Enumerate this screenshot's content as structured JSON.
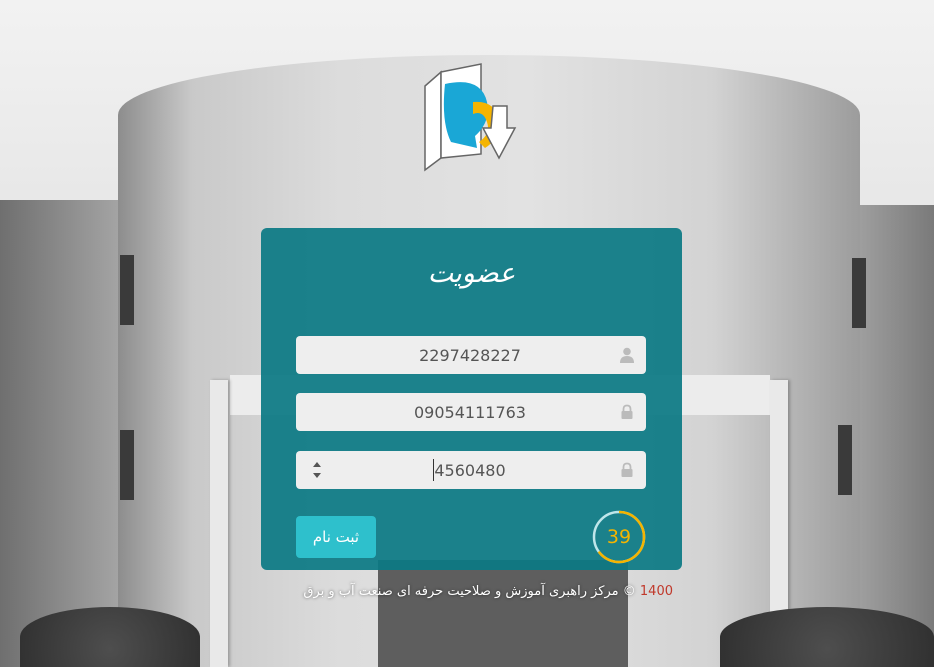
{
  "card": {
    "title": "عضویت",
    "fields": [
      {
        "value": "2297428227",
        "icon": "user-icon"
      },
      {
        "value": "09054111763",
        "icon": "lock-icon"
      },
      {
        "value": "4560480",
        "icon": "lock-icon"
      }
    ],
    "submit_label": "ثبت نام",
    "timer": "39"
  },
  "footer": {
    "year": "1400",
    "copyright_symbol": "©",
    "org": "مرکز راهبری آموزش و صلاحیت حرفه ای صنعت آب و برق"
  },
  "colors": {
    "card_bg": "#0c7a84",
    "button_bg": "#2ec0cc",
    "timer": "#f4b400",
    "year": "#c0392b"
  }
}
